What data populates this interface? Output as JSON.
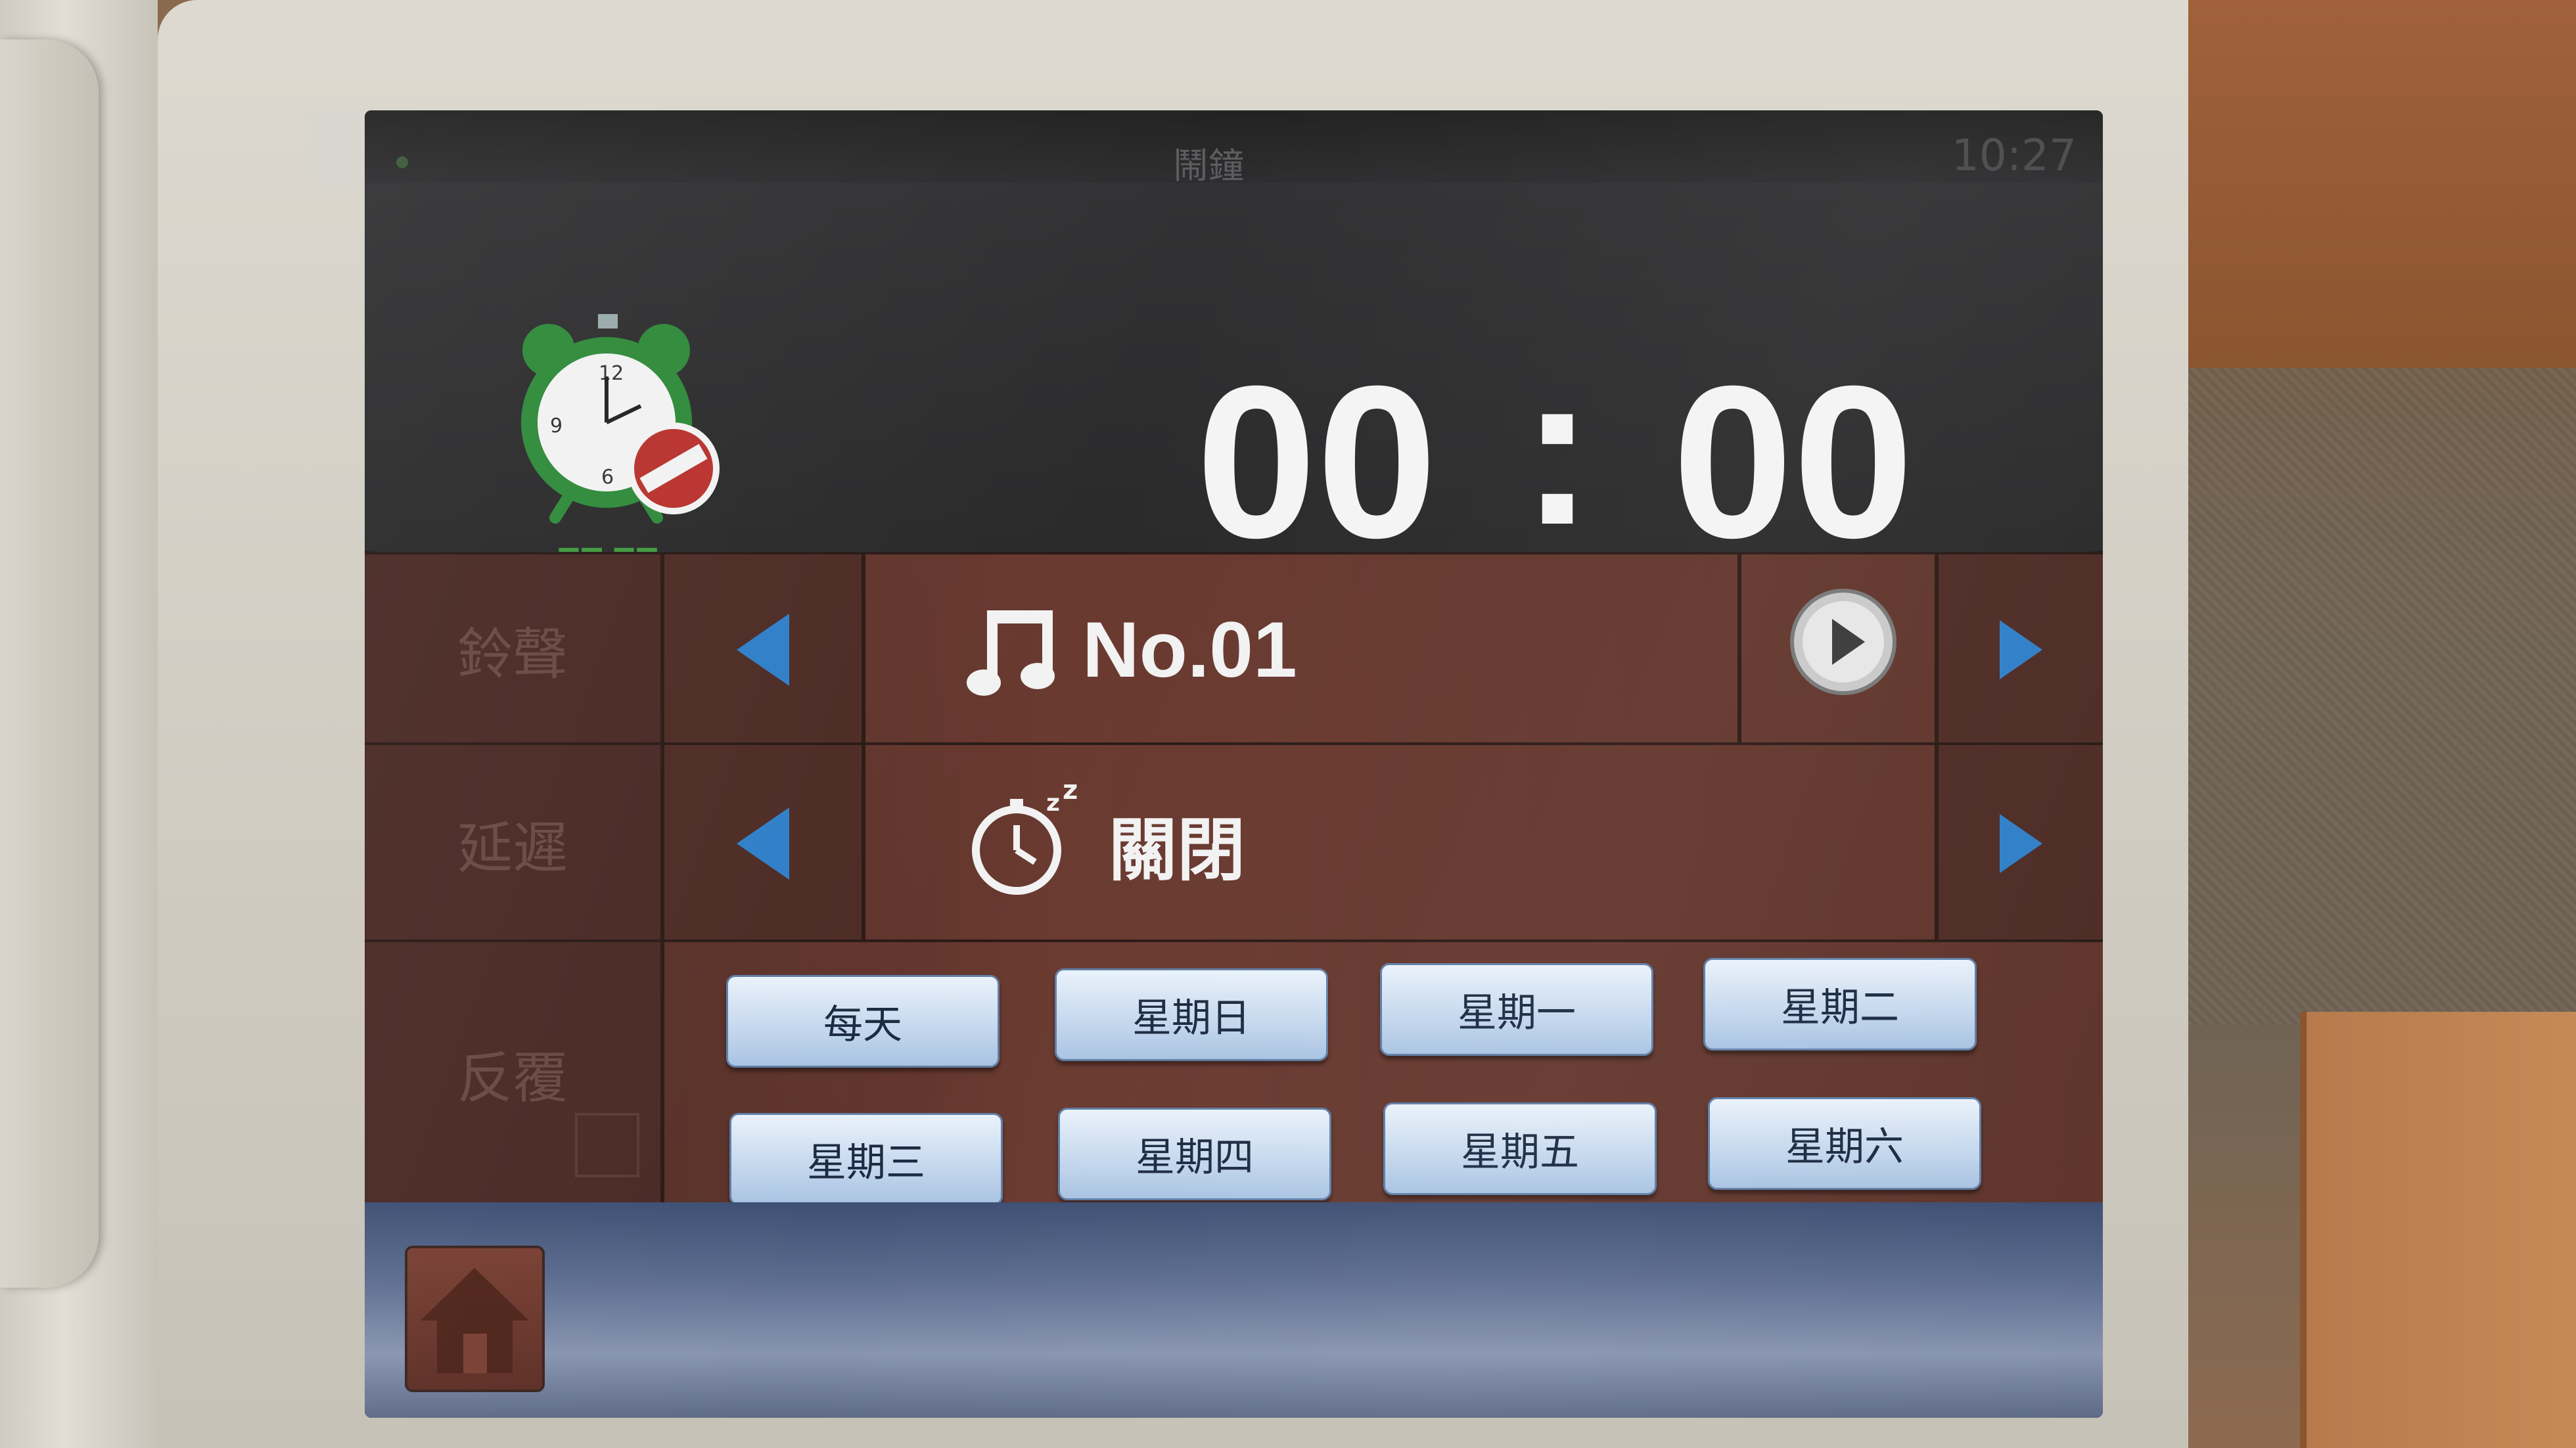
{
  "status_bar": {
    "title": "鬧鐘",
    "time": "10:27"
  },
  "alarm": {
    "status_label": "關閉",
    "icon": "alarm-clock-off-icon",
    "hours": "00",
    "separator": ":",
    "minutes": "00"
  },
  "ring": {
    "label": "鈴聲",
    "value": "No.01",
    "icon": "music-note-icon",
    "play_icon": "play-icon"
  },
  "snooze": {
    "label": "延遲",
    "value": "關閉",
    "icon": "snooze-clock-icon"
  },
  "repeat": {
    "label": "反覆",
    "days": [
      "每天",
      "星期日",
      "星期一",
      "星期二",
      "星期三",
      "星期四",
      "星期五",
      "星期六"
    ]
  },
  "nav": {
    "home_icon": "home-icon"
  },
  "colors": {
    "accent_green": "#3f9a3f",
    "arrow_blue": "#2f7fc8",
    "row_brown": "#5e342b",
    "button_blue": "#c7d9ee"
  }
}
